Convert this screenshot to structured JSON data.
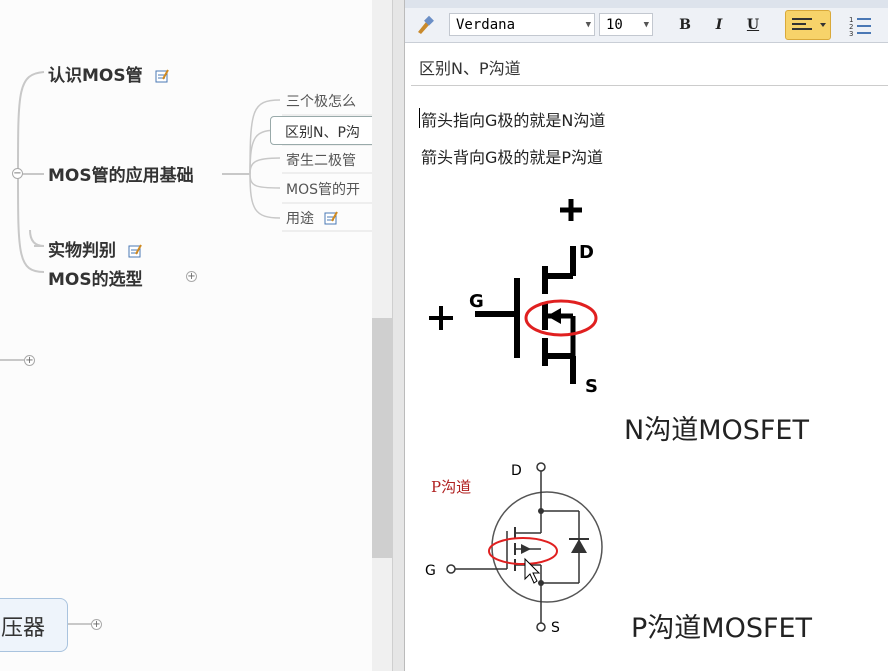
{
  "mindmap": {
    "node_recognize": "认识MOS管",
    "node_basics": "MOS管的应用基础",
    "node_identify": "实物判别",
    "node_select": "MOS的选型",
    "sub_items": [
      "三个极怎么",
      "区别N、P沟",
      "寄生二极管",
      "MOS管的开",
      "用途"
    ],
    "node_bottom": "压器"
  },
  "toolbar": {
    "font_name": "Verdana",
    "font_size": "10",
    "bold_label": "B",
    "italic_label": "I",
    "underline_label": "U"
  },
  "editor": {
    "title": "区别N、P沟道",
    "line1": "箭头指向G极的就是N沟道",
    "line2": "箭头背向G极的就是P沟道"
  },
  "figure_n": {
    "plus_top": "+",
    "plus_left": "+",
    "label_g": "G",
    "label_d": "D",
    "label_s": "S",
    "caption": "N沟道MOSFET"
  },
  "figure_p": {
    "handwritten": "P沟道",
    "label_d": "D",
    "label_g": "G",
    "label_s": "S",
    "caption": "P沟道MOSFET"
  },
  "colors": {
    "accent": "#f5c23e",
    "circle": "#e02020",
    "mindmap_line": "#c8c8c8"
  }
}
